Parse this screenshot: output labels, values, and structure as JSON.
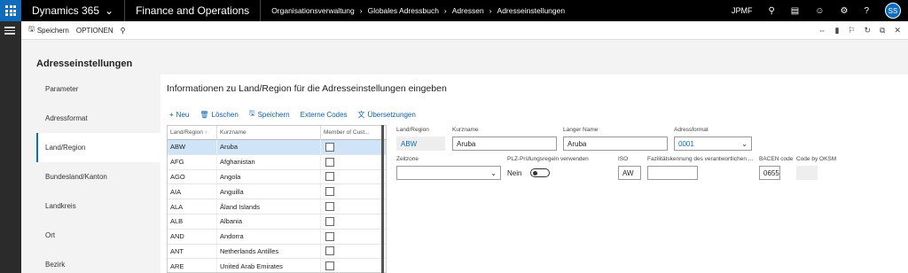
{
  "topbar": {
    "brand": "Dynamics 365",
    "app_name": "Finance and Operations",
    "breadcrumbs": [
      "Organisationsverwaltung",
      "Globales Adressbuch",
      "Adressen",
      "Adresseinstellungen"
    ],
    "company": "JPMF",
    "user_initials": "SS"
  },
  "actionbar": {
    "save_label": "Speichern",
    "options_label": "OPTIONEN"
  },
  "page": {
    "title": "Adresseinstellungen"
  },
  "nav": {
    "items": [
      {
        "label": "Parameter"
      },
      {
        "label": "Adressformat"
      },
      {
        "label": "Land/Region"
      },
      {
        "label": "Bundesland/Kanton"
      },
      {
        "label": "Landkreis"
      },
      {
        "label": "Ort"
      },
      {
        "label": "Bezirk"
      }
    ]
  },
  "panel": {
    "title": "Informationen zu Land/Region für die Adresseinstellungen eingeben",
    "toolbar": {
      "new": "Neu",
      "delete": "Löschen",
      "save": "Speichern",
      "external_codes": "Externe Codes",
      "translations": "Übersetzungen"
    }
  },
  "grid": {
    "headers": [
      "Land/Region",
      "Kurzname",
      "Member of Cust..."
    ],
    "rows": [
      {
        "code": "ABW",
        "name": "Aruba"
      },
      {
        "code": "AFG",
        "name": "Afghanistan"
      },
      {
        "code": "AGO",
        "name": "Angola"
      },
      {
        "code": "AIA",
        "name": "Anguilla"
      },
      {
        "code": "ALA",
        "name": "Åland Islands"
      },
      {
        "code": "ALB",
        "name": "Albania"
      },
      {
        "code": "AND",
        "name": "Andorra"
      },
      {
        "code": "ANT",
        "name": "Netherlands Antilles"
      },
      {
        "code": "ARE",
        "name": "United Arab Emirates"
      }
    ]
  },
  "details": {
    "country_label": "Land/Region",
    "country_value": "ABW",
    "short_label": "Kurzname",
    "short_value": "Aruba",
    "long_label": "Langer Name",
    "long_value": "Aruba",
    "format_label": "Adressformat",
    "format_value": "0001",
    "timezone_label": "Zeitzone",
    "timezone_value": "",
    "zip_label": "PLZ-Prüfungsregeln verwenden",
    "zip_value": "Nein",
    "iso_label": "ISO",
    "iso_value": "AW",
    "facility_label": "Fazilitätskennung des verantwortlichen ...",
    "facility_value": "",
    "bacen_label": "BACEN code",
    "bacen_value": "0655",
    "oksm_label": "Code by OKSM",
    "oksm_value": ""
  }
}
